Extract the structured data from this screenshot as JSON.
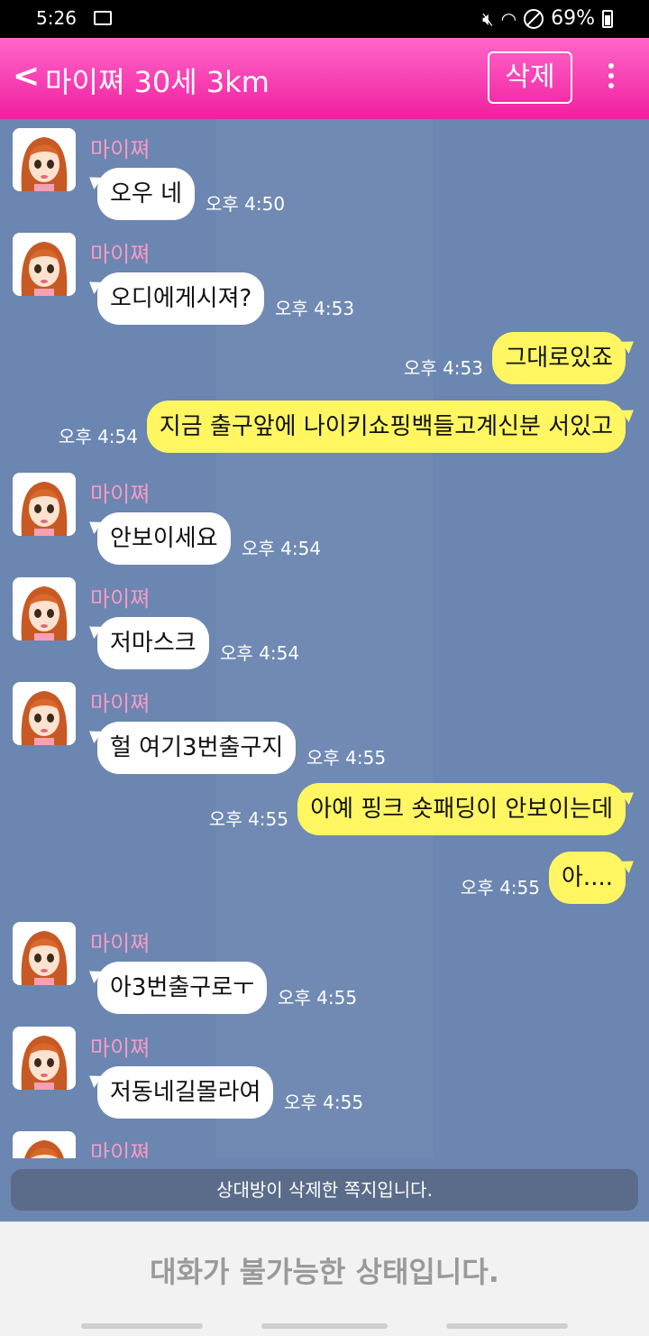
{
  "status": {
    "time": "5:26",
    "battery": "69%"
  },
  "header": {
    "back_label": "<",
    "title": "마이쪄 30세 3km",
    "delete_label": "삭제"
  },
  "messages": [
    {
      "dir": "in",
      "sender": "마이쪄",
      "text": "오우 네",
      "time": "오후 4:50"
    },
    {
      "dir": "in",
      "sender": "마이쪄",
      "text": "오디에게시져?",
      "time": "오후 4:53"
    },
    {
      "dir": "out",
      "text": "그대로있죠",
      "time": "오후 4:53"
    },
    {
      "dir": "out",
      "text": "지금 출구앞에 나이키쇼핑백들고계신분 서있고",
      "time": "오후 4:54"
    },
    {
      "dir": "in",
      "sender": "마이쪄",
      "text": "안보이세요",
      "time": "오후 4:54"
    },
    {
      "dir": "in",
      "sender": "마이쪄",
      "text": "저마스크",
      "time": "오후 4:54"
    },
    {
      "dir": "in",
      "sender": "마이쪄",
      "text": "헐 여기3번출구지",
      "time": "오후 4:55"
    },
    {
      "dir": "out",
      "text": "아예 핑크 숏패딩이 안보이는데",
      "time": "오후 4:55"
    },
    {
      "dir": "out",
      "text": "아....",
      "time": "오후 4:55"
    },
    {
      "dir": "in",
      "sender": "마이쪄",
      "text": "아3번출구로ㅜ",
      "time": "오후 4:55"
    },
    {
      "dir": "in",
      "sender": "마이쪄",
      "text": "저동네길몰라여",
      "time": "오후 4:55"
    },
    {
      "dir": "in",
      "sender": "마이쪄",
      "text": "",
      "time": ""
    }
  ],
  "notice": "상대방이 삭제한 쪽지입니다.",
  "footer": {
    "text": "대화가 불가능한 상태입니다."
  }
}
